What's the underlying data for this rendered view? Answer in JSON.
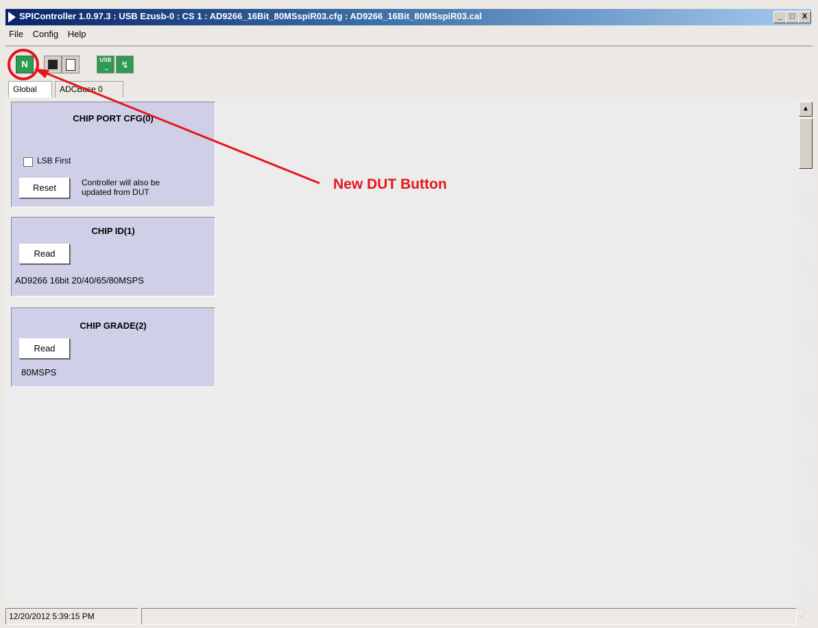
{
  "window": {
    "title": "SPIController 1.0.97.3 : USB Ezusb-0 : CS 1 : AD9266_16Bit_80MSspiR03.cfg : AD9266_16Bit_80MSspiR03.cal",
    "controls": {
      "minimize": "_",
      "maximize": "□",
      "close": "X"
    }
  },
  "menu": [
    "File",
    "Config",
    "Help"
  ],
  "toolbar": {
    "buttons": [
      {
        "icon": "new-dut-icon",
        "label": "N"
      },
      {
        "icon": "chip-icon",
        "label": ""
      },
      {
        "icon": "register-map-icon",
        "label": ""
      },
      {
        "icon": "usb-icon",
        "label": "USB"
      },
      {
        "icon": "waveform-icon",
        "label": ""
      }
    ]
  },
  "tabs": [
    "Global",
    "ADCBase 0"
  ],
  "panels": {
    "port_cfg": {
      "title": "CHIP PORT CFG(0)",
      "checkbox_label": "LSB First",
      "button": "Reset",
      "note": "Controller will also be updated from DUT"
    },
    "chip_id": {
      "title": "CHIP ID(1)",
      "button": "Read",
      "value": "AD9266 16bit 20/40/65/80MSPS"
    },
    "chip_grade": {
      "title": "CHIP GRADE(2)",
      "button": "Read",
      "value": "80MSPS"
    }
  },
  "statusbar": {
    "timestamp": "12/20/2012 5:39:15 PM"
  },
  "annotation": {
    "text": "New DUT Button",
    "color": "#e8141c"
  },
  "colors": {
    "panel_bg": "#cfcfe8",
    "titlebar": "#0a246a",
    "button_green": "#2f9a52"
  }
}
